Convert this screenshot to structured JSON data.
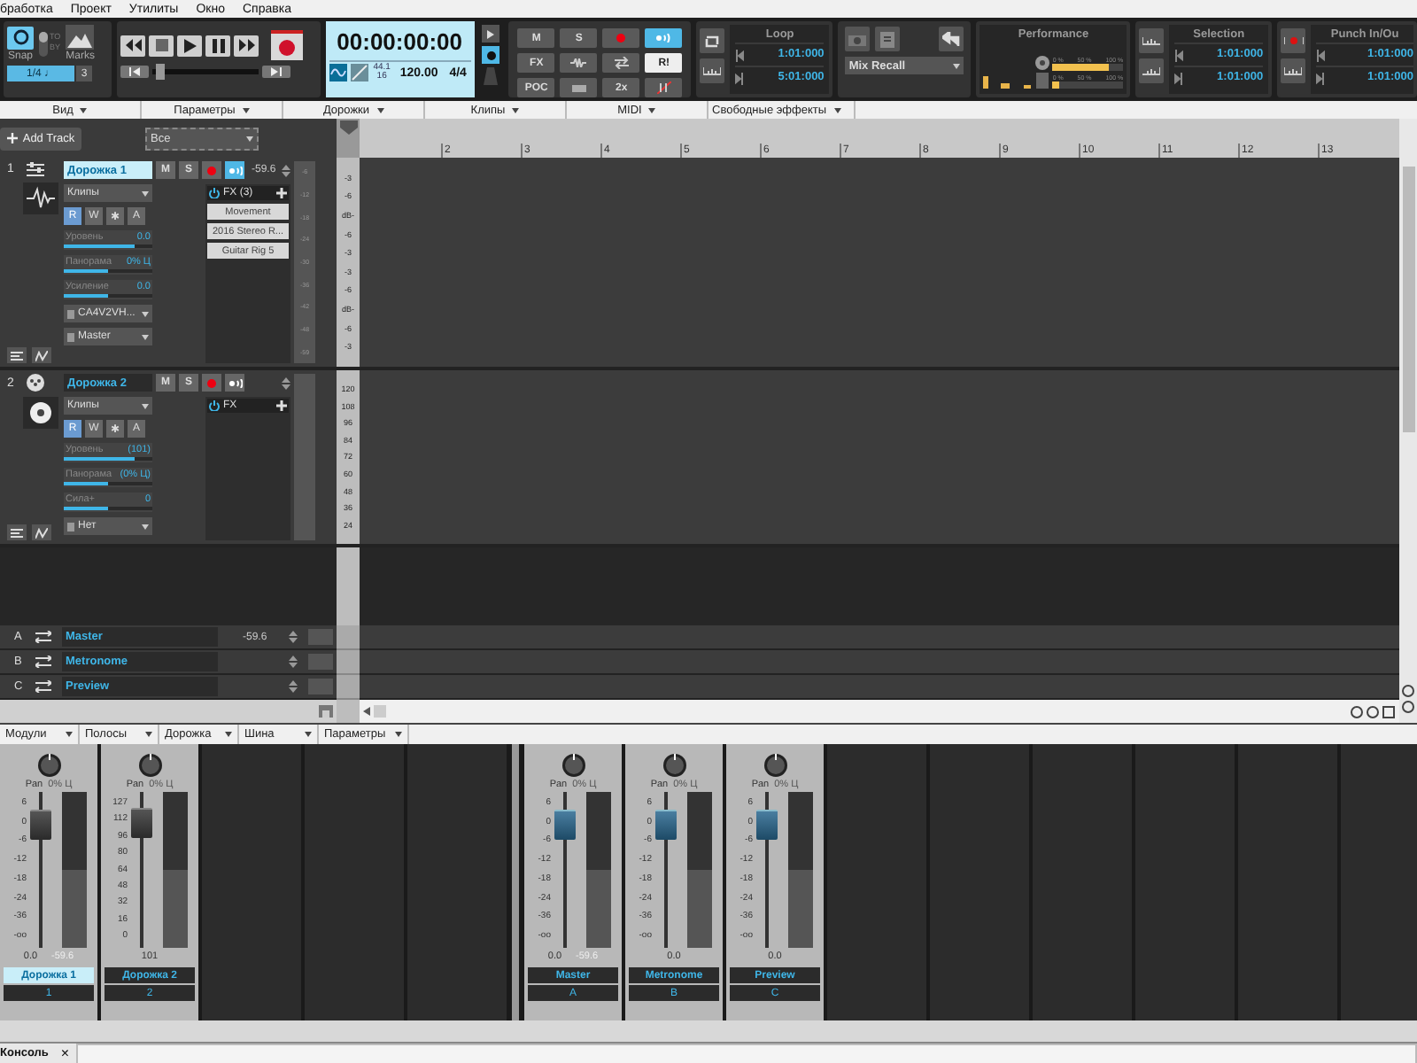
{
  "menu_bar": [
    "бработка",
    "Проект",
    "Утилиты",
    "Окно",
    "Справка"
  ],
  "control_bar": {
    "snap": {
      "label": "Snap",
      "value": "1/4",
      "note": "♩",
      "triplet": "3",
      "on": true
    },
    "snap_mode": {
      "on": false,
      "labels": [
        "TO",
        "BY"
      ]
    },
    "marks": {
      "label": "Marks"
    },
    "now_slider": {
      "level": 0.06
    },
    "time": "00:00:00:00",
    "sample_rate": "44.1",
    "bit_depth": "16",
    "tempo": "120.00",
    "meter": "4/4",
    "mix_buttons": [
      {
        "kind": "text",
        "label": "M",
        "on": false
      },
      {
        "kind": "text",
        "label": "S",
        "on": false
      },
      {
        "kind": "record",
        "on": false
      },
      {
        "kind": "echo",
        "on": true
      },
      {
        "kind": "text",
        "label": "FX",
        "on": false
      },
      {
        "kind": "wave",
        "on": false
      },
      {
        "kind": "swap",
        "on": false
      },
      {
        "kind": "text",
        "label": "R!",
        "on": true
      },
      {
        "kind": "text",
        "label": "POC",
        "on": false
      },
      {
        "kind": "dim",
        "on": false
      },
      {
        "kind": "text",
        "label": "2x",
        "on": false
      },
      {
        "kind": "strike",
        "on": false
      }
    ],
    "loop": {
      "title": "Loop",
      "start": "1:01:000",
      "end": "5:01:000"
    },
    "mix_recall": "Mix Recall",
    "performance": {
      "title": "Performance",
      "meters": [
        {
          "scale": [
            "0 %",
            "50 %",
            "100 %"
          ],
          "level": 0.8
        },
        {
          "scale": [
            "0 %",
            "50 %",
            "100 %"
          ],
          "level": 0.1
        }
      ]
    },
    "selection": {
      "title": "Selection",
      "start": "1:01:000",
      "end": "1:01:000"
    },
    "punch": {
      "title": "Punch In/Ou",
      "start": "1:01:000",
      "end": "1:01:000"
    }
  },
  "view_menu": [
    "Вид",
    "Параметры",
    "Дорожки",
    "Клипы",
    "MIDI",
    "Свободные эффекты"
  ],
  "track_view": {
    "add_track": "Add Track",
    "filter": "Все",
    "ruler": [
      "2",
      "3",
      "4",
      "5",
      "6",
      "7",
      "8",
      "9",
      "10",
      "11",
      "12",
      "13"
    ],
    "tracks": [
      {
        "kind": "audio",
        "number": "1",
        "name": "Дорожка 1",
        "selected": true,
        "mute_label": "M",
        "solo_label": "S",
        "muted": false,
        "soloed": false,
        "armed": false,
        "echo": true,
        "reading": "-59.6",
        "input": "Клипы",
        "automation": [
          "R",
          "W",
          "✱",
          "A"
        ],
        "read": true,
        "params": [
          {
            "label": "Уровень",
            "value": "0.0",
            "level": 0.8
          },
          {
            "label": "Панорама",
            "value": "0% Ц",
            "level": 0.5
          },
          {
            "label": "Усиление",
            "value": "0.0",
            "level": 0.5
          }
        ],
        "io": [
          "CA4V2VH...",
          "Master"
        ],
        "fx": {
          "title": "FX (3)",
          "plugins": [
            "Movement",
            "2016 Stereo R...",
            "Guitar Rig 5"
          ]
        },
        "meter_scale": [
          "-6",
          "-12",
          "-18",
          "-24",
          "-30",
          "-36",
          "-42",
          "-48",
          "-59"
        ],
        "scale": [
          "-3",
          "-6",
          "dB-",
          "-6",
          "-3",
          "-3",
          "-6",
          "dB-",
          "-6",
          "-3"
        ]
      },
      {
        "kind": "midi",
        "number": "2",
        "name": "Дорожка 2",
        "selected": false,
        "mute_label": "M",
        "solo_label": "S",
        "muted": false,
        "soloed": false,
        "armed": false,
        "echo": false,
        "input": "Клипы",
        "automation": [
          "R",
          "W",
          "✱",
          "A"
        ],
        "read": true,
        "params": [
          {
            "label": "Уровень",
            "value": "(101)",
            "level": 0.8
          },
          {
            "label": "Панорама",
            "value": "(0% Ц)",
            "level": 0.5
          },
          {
            "label": "Сила+",
            "value": "0",
            "level": 0.5
          }
        ],
        "io": [
          "Нет"
        ],
        "fx": {
          "title": "FX"
        },
        "scale": [
          "120",
          "108",
          "96",
          "84",
          "72",
          "60",
          "48",
          "36",
          "24"
        ]
      }
    ],
    "buses": [
      {
        "letter": "A",
        "name": "Master",
        "reading": "-59.6"
      },
      {
        "letter": "B",
        "name": "Metronome"
      },
      {
        "letter": "C",
        "name": "Preview"
      }
    ]
  },
  "console_menu": [
    "Модули",
    "Полосы",
    "Дорожка",
    "Шина",
    "Параметры"
  ],
  "strips": [
    {
      "kind": "track",
      "name": "Дорожка 1",
      "number": "1",
      "selected": true,
      "pan": "Pan",
      "pan_value": "0% Ц",
      "scale": [
        "6",
        "0",
        "-6",
        "-12",
        "-18",
        "-24",
        "-36",
        "-oo"
      ],
      "level": 0.78,
      "value": "0.0",
      "peak": "-59.6"
    },
    {
      "kind": "track",
      "name": "Дорожка 2",
      "number": "2",
      "selected": false,
      "pan": "Pan",
      "pan_value": "0% Ц",
      "scale": [
        "127",
        "112",
        "96",
        "80",
        "64",
        "48",
        "32",
        "16",
        "0"
      ],
      "level": 0.79,
      "value": "101"
    },
    {
      "kind": "bus",
      "name": "Master",
      "number": "A",
      "selected": false,
      "pan": "Pan",
      "pan_value": "0% Ц",
      "scale": [
        "6",
        "0",
        "-6",
        "-12",
        "-18",
        "-24",
        "-36",
        "-oo"
      ],
      "level": 0.78,
      "value": "0.0",
      "peak": "-59.6"
    },
    {
      "kind": "bus",
      "name": "Metronome",
      "number": "B",
      "selected": false,
      "pan": "Pan",
      "pan_value": "0% Ц",
      "scale": [
        "6",
        "0",
        "-6",
        "-12",
        "-18",
        "-24",
        "-36",
        "-oo"
      ],
      "level": 0.78,
      "value": "0.0"
    },
    {
      "kind": "bus",
      "name": "Preview",
      "number": "C",
      "selected": false,
      "pan": "Pan",
      "pan_value": "0% Ц",
      "scale": [
        "6",
        "0",
        "-6",
        "-12",
        "-18",
        "-24",
        "-36",
        "-oo"
      ],
      "level": 0.78,
      "value": "0.0"
    }
  ],
  "bottom_tab": {
    "label": "Консоль",
    "close": "×"
  }
}
